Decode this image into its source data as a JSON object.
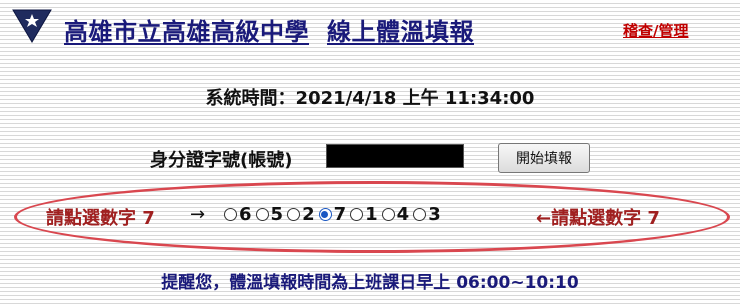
{
  "header": {
    "school_name": "高雄市立高雄高級中學",
    "system_name": "線上體溫填報",
    "admin_link": "稽查/管理"
  },
  "system_time": {
    "text": "系統時間：2021/4/18 上午 11:34:00"
  },
  "login": {
    "id_label": "身分證字號(帳號)",
    "id_value": "",
    "start_button": "開始填報"
  },
  "captcha": {
    "hint_left": "請點選數字 7",
    "arrow_right": "→",
    "hint_right": "←請點選數字 7",
    "options": [
      {
        "label": "6",
        "checked": false
      },
      {
        "label": "5",
        "checked": false
      },
      {
        "label": "2",
        "checked": false
      },
      {
        "label": "7",
        "checked": true
      },
      {
        "label": "1",
        "checked": false
      },
      {
        "label": "4",
        "checked": false
      },
      {
        "label": "3",
        "checked": false
      }
    ],
    "highlight_color": "#d9474f"
  },
  "reminder": {
    "text": "提醒您，體溫填報時間為上班課日早上 06:00~10:10"
  },
  "colors": {
    "title": "#1a1a7a",
    "admin": "#c00000",
    "hint": "#a02020",
    "radio_selected": "#1a57c2"
  }
}
